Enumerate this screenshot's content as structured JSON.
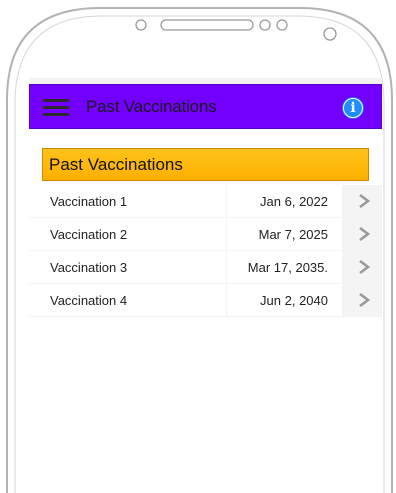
{
  "app_bar": {
    "title": "Past Vaccinations",
    "background": "#7300ff"
  },
  "section": {
    "title": "Past Vaccinations",
    "background": "#ffb000"
  },
  "vaccinations": [
    {
      "name": "Vaccination 1",
      "date": "Jan 6, 2022"
    },
    {
      "name": "Vaccination 2",
      "date": "Mar 7, 2025"
    },
    {
      "name": "Vaccination 3",
      "date": "Mar 17, 2035."
    },
    {
      "name": "Vaccination 4",
      "date": "Jun 2, 2040"
    }
  ],
  "icons": {
    "menu": "hamburger-menu-icon",
    "info": "info-icon",
    "row_action": "chevron-right-icon"
  }
}
